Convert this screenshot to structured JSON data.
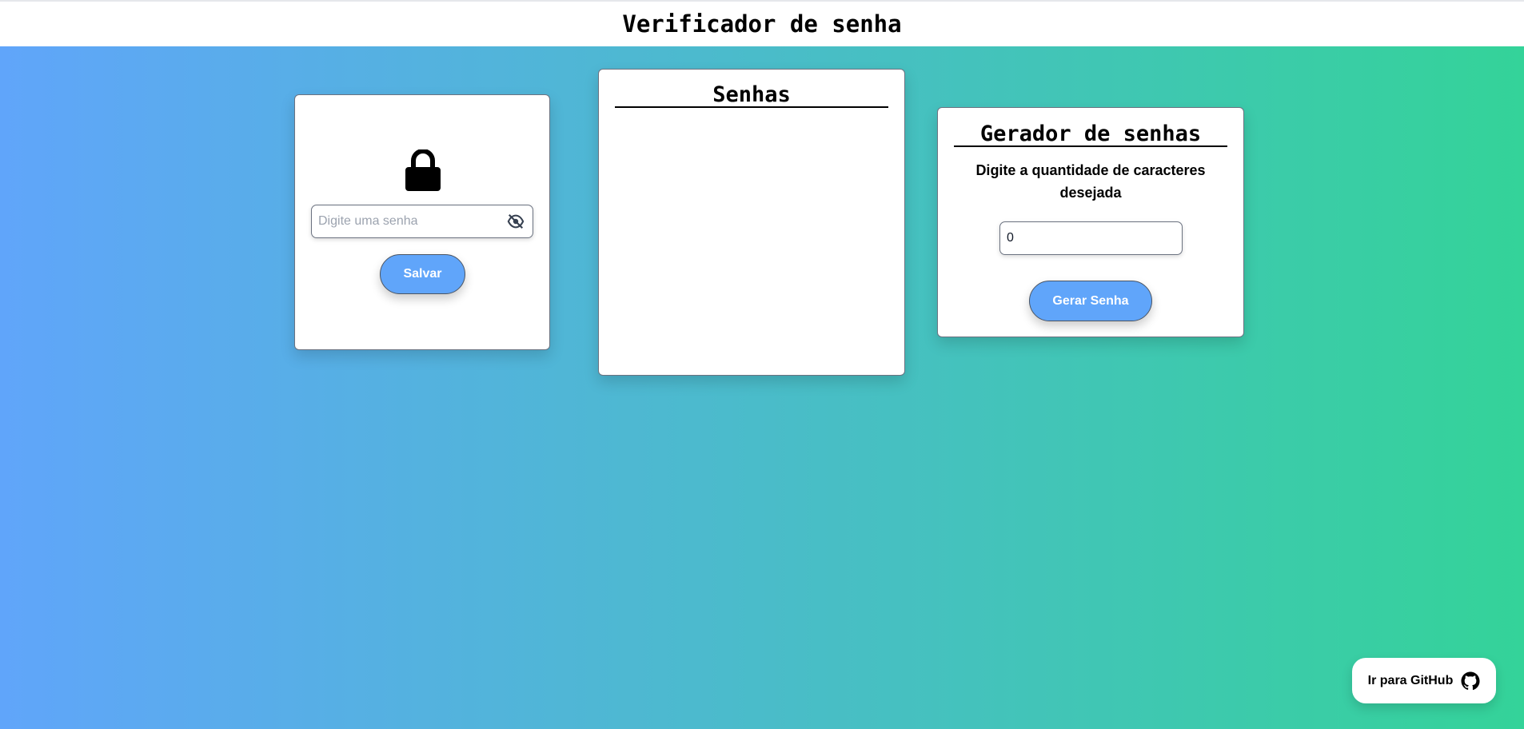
{
  "header": {
    "title": "Verificador de senha"
  },
  "password_card": {
    "icon": "lock-icon",
    "input_placeholder": "Digite uma senha",
    "input_value": "",
    "visibility_icon": "eye-slash-icon",
    "save_label": "Salvar"
  },
  "list_card": {
    "title": "Senhas",
    "items": []
  },
  "generator_card": {
    "title": "Gerador de senhas",
    "label": "Digite a quantidade de caracteres desejada",
    "quantity_value": "0",
    "generate_label": "Gerar Senha"
  },
  "github_button": {
    "label": "Ir para GitHub",
    "icon": "github-icon"
  },
  "colors": {
    "gradient_start": "#60a5fa",
    "gradient_end": "#34d399",
    "button_blue": "#60a5fa"
  }
}
